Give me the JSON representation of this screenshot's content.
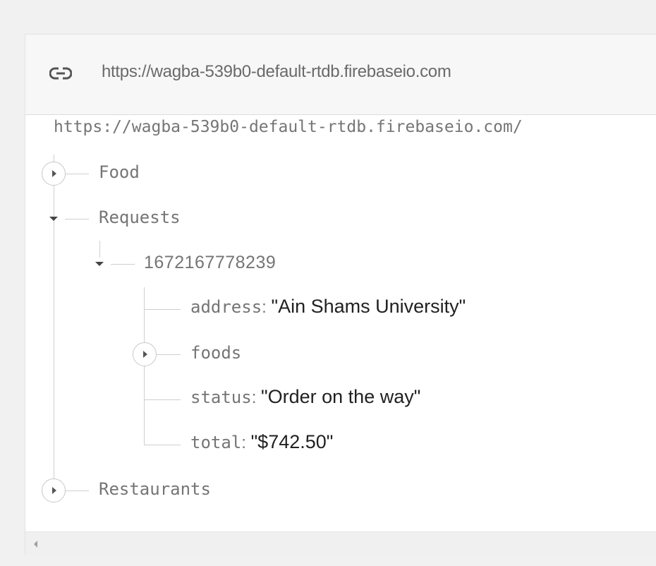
{
  "header": {
    "url": "https://wagba-539b0-default-rtdb.firebaseio.com",
    "icon": "link-icon"
  },
  "tree": {
    "root_url": "https://wagba-539b0-default-rtdb.firebaseio.com/",
    "food": {
      "label": "Food",
      "expanded": false
    },
    "requests": {
      "label": "Requests",
      "expanded": true,
      "request": {
        "id": "1672167778239",
        "expanded": true,
        "address": {
          "key": "address",
          "value": "\"Ain Shams University\""
        },
        "foods": {
          "label": "foods",
          "expanded": false
        },
        "status": {
          "key": "status",
          "value": "\"Order on the way\""
        },
        "total": {
          "key": "total",
          "value": "\"$742.50\""
        }
      }
    },
    "restaurants": {
      "label": "Restaurants",
      "expanded": false
    }
  },
  "separator": ":"
}
